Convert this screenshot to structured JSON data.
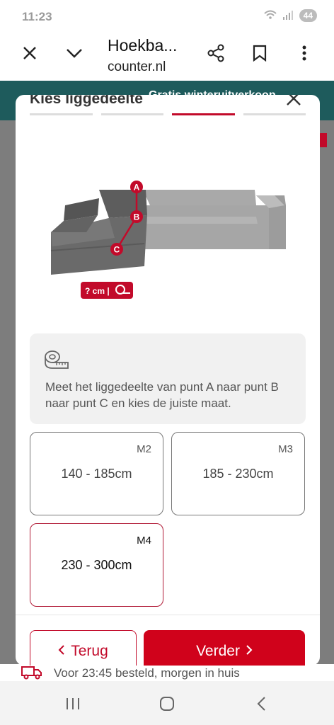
{
  "status": {
    "time": "11:23",
    "battery": "44"
  },
  "browser": {
    "title": "Hoekba...",
    "url": "counter.nl"
  },
  "background": {
    "banner_text": "Gratis winteruitverkoop",
    "footer_text": "Voor 23:45 besteld, morgen in huis"
  },
  "modal": {
    "title": "Kies liggedeelte",
    "steps": [
      {
        "active": false
      },
      {
        "active": false
      },
      {
        "active": true
      },
      {
        "active": false
      }
    ],
    "image": {
      "points": [
        "A",
        "B",
        "C"
      ],
      "measure_label": "? cm |"
    },
    "info_text": "Meet het liggedeelte van punt A naar punt B naar punt C en kies de juiste maat.",
    "sizes": [
      {
        "code": "M2",
        "range": "140 - 185cm",
        "selected": false
      },
      {
        "code": "M3",
        "range": "185 - 230cm",
        "selected": false
      },
      {
        "code": "M4",
        "range": "230 - 300cm",
        "selected": true
      }
    ],
    "back_label": "Terug",
    "next_label": "Verder"
  },
  "colors": {
    "accent": "#d0021b",
    "selected_border": "#b11b37",
    "banner": "#1e5b5c"
  }
}
